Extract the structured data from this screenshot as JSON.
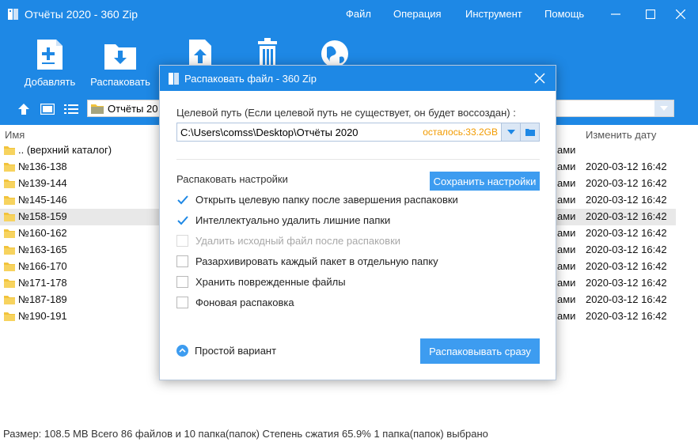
{
  "window": {
    "title": "Отчёты 2020 - 360 Zip",
    "menu": [
      "Файл",
      "Операция",
      "Инструмент",
      "Помощь"
    ]
  },
  "toolbar": {
    "add": "Добавлять",
    "extract": "Распаковать"
  },
  "path": {
    "value": "Отчёты 20"
  },
  "columns": {
    "name": "Имя",
    "date": "Изменить дату"
  },
  "files": [
    {
      "name": ".. (верхний каталог)",
      "type": "ами",
      "date": ""
    },
    {
      "name": "№136-138",
      "type": "ами",
      "date": "2020-03-12 16:42"
    },
    {
      "name": "№139-144",
      "type": "ами",
      "date": "2020-03-12 16:42"
    },
    {
      "name": "№145-146",
      "type": "ами",
      "date": "2020-03-12 16:42"
    },
    {
      "name": "№158-159",
      "type": "ами",
      "date": "2020-03-12 16:42"
    },
    {
      "name": "№160-162",
      "type": "ами",
      "date": "2020-03-12 16:42"
    },
    {
      "name": "№163-165",
      "type": "ами",
      "date": "2020-03-12 16:42"
    },
    {
      "name": "№166-170",
      "type": "ами",
      "date": "2020-03-12 16:42"
    },
    {
      "name": "№171-178",
      "type": "ами",
      "date": "2020-03-12 16:42"
    },
    {
      "name": "№187-189",
      "type": "ами",
      "date": "2020-03-12 16:42"
    },
    {
      "name": "№190-191",
      "type": "ами",
      "date": "2020-03-12 16:42"
    }
  ],
  "selected_row": 4,
  "status": "Размер: 108.5 MB Всего 86 файлов и 10 папка(папок) Степень сжатия 65.9% 1 папка(папок) выбрано",
  "dialog": {
    "title": "Распаковать файл - 360 Zip",
    "dest_label": "Целевой путь (Если целевой путь не существует, он будет воссоздан) :",
    "dest_value": "C:\\Users\\comss\\Desktop\\Отчёты 2020",
    "free_space": "осталось:33.2GB",
    "options_label": "Распаковать настройки",
    "save_button": "Сохранить настройки",
    "options": [
      {
        "label": "Открыть целевую папку после завершения распаковки",
        "checked": true,
        "enabled": true
      },
      {
        "label": "Интеллектуально удалить лишние папки",
        "checked": true,
        "enabled": true
      },
      {
        "label": "Удалить исходный файл после распаковки",
        "checked": false,
        "enabled": false
      },
      {
        "label": "Разархивировать каждый пакет в отдельную папку",
        "checked": false,
        "enabled": true
      },
      {
        "label": "Хранить поврежденные файлы",
        "checked": false,
        "enabled": true
      },
      {
        "label": "Фоновая распаковка",
        "checked": false,
        "enabled": true
      }
    ],
    "simple_mode": "Простой вариант",
    "extract_button": "Распаковывать сразу"
  },
  "colors": {
    "header": "#1e88e5",
    "accent_button": "#3d9cf0",
    "folder": "#f2c33b",
    "free_space": "#f29b00"
  },
  "icons": [
    "app-icon",
    "add-icon",
    "extract-icon",
    "upload-icon",
    "delete-icon",
    "globe-icon",
    "up-arrow-icon",
    "view-icon",
    "list-icon",
    "folder-icon",
    "chevron-down-icon",
    "close-icon",
    "check-icon",
    "chevron-up-icon"
  ]
}
